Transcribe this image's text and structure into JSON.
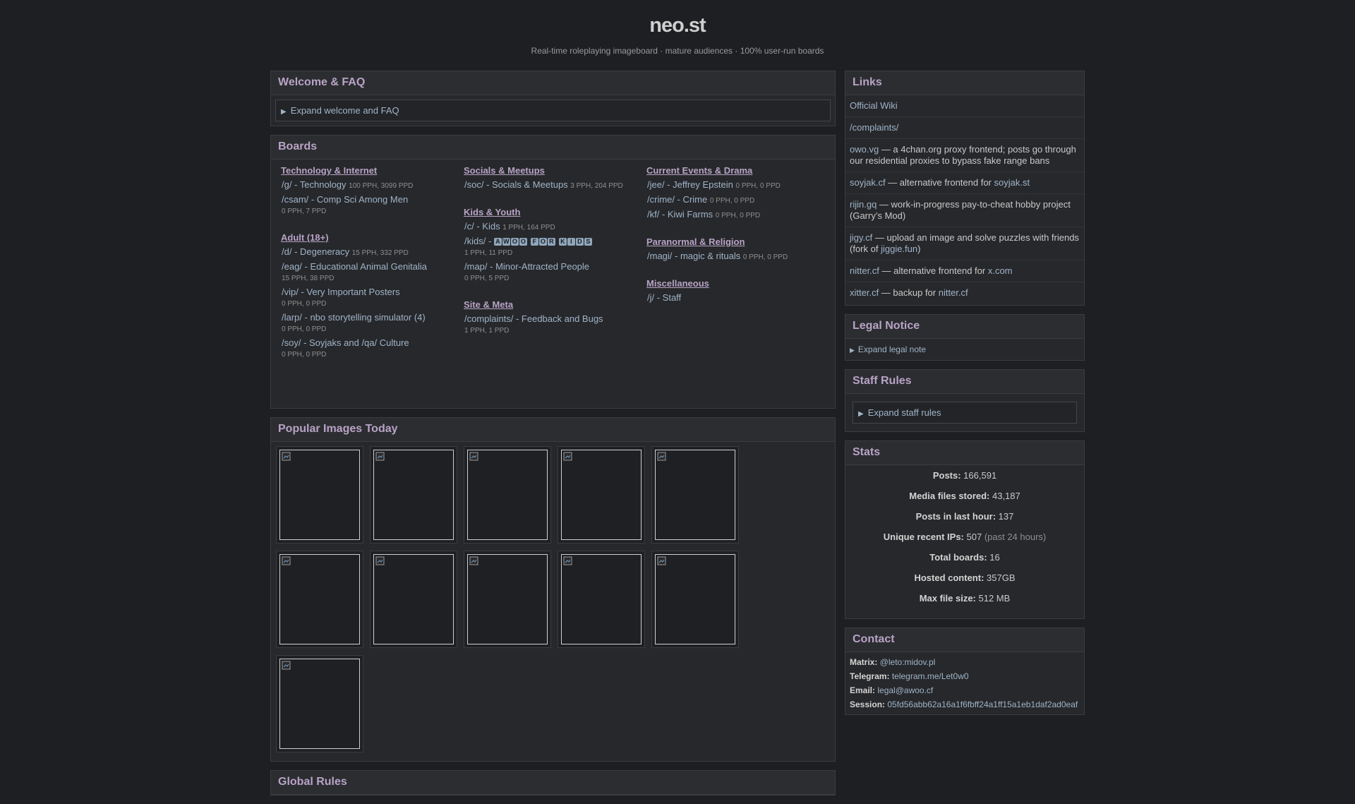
{
  "site": {
    "title": "neo.st",
    "tagline": "Real-time roleplaying imageboard · mature audiences · 100% user-run boards"
  },
  "welcome": {
    "title": "Welcome & FAQ",
    "expand_label": "Expand welcome and FAQ"
  },
  "boards_panel": {
    "title": "Boards",
    "columns": [
      [
        {
          "name": "Technology & Internet",
          "boards": [
            {
              "label": "/g/ - Technology",
              "stat": "100 PPH, 3099 PPD",
              "stat_block": false
            },
            {
              "label": "/csam/ - Comp Sci Among Men",
              "stat": "0 PPH, 7 PPD",
              "stat_block": true
            }
          ]
        },
        {
          "name": "Adult (18+)",
          "boards": [
            {
              "label": "/d/ - Degeneracy",
              "stat": "15 PPH, 332 PPD",
              "stat_block": false
            },
            {
              "label": "/eag/ - Educational Animal Genitalia",
              "stat": "15 PPH, 38 PPD",
              "stat_block": true
            },
            {
              "label": "/vip/ - Very Important Posters",
              "stat": "0 PPH, 0 PPD",
              "stat_block": true
            },
            {
              "label": "/larp/ - nbo storytelling simulator (4)",
              "stat": "0 PPH, 0 PPD",
              "stat_block": true
            },
            {
              "label": "/soy/ - Soyjaks and /qa/ Culture",
              "stat": "0 PPH, 0 PPD",
              "stat_block": true
            }
          ]
        }
      ],
      [
        {
          "name": "Socials & Meetups",
          "boards": [
            {
              "label": "/soc/ - Socials & Meetups",
              "stat": "3 PPH, 204 PPD",
              "stat_block": false
            }
          ]
        },
        {
          "name": "Kids & Youth",
          "boards": [
            {
              "label": "/c/ - Kids",
              "stat": "1 PPH, 164 PPD",
              "stat_block": false
            },
            {
              "label": "/kids/ - ",
              "chips": "AWOO FOR KIDS",
              "stat": "1 PPH, 11 PPD",
              "stat_block": true
            },
            {
              "label": "/map/ - Minor-Attracted People",
              "stat": "0 PPH, 5 PPD",
              "stat_block": true
            }
          ]
        },
        {
          "name": "Site & Meta",
          "boards": [
            {
              "label": "/complaints/ - Feedback and Bugs",
              "stat": "1 PPH, 1 PPD",
              "stat_block": true
            }
          ]
        }
      ],
      [
        {
          "name": "Current Events & Drama",
          "boards": [
            {
              "label": "/jee/ - Jeffrey Epstein",
              "stat": "0 PPH, 0 PPD",
              "stat_block": false
            },
            {
              "label": "/crime/ - Crime",
              "stat": "0 PPH, 0 PPD",
              "stat_block": false
            },
            {
              "label": "/kf/ - Kiwi Farms",
              "stat": "0 PPH, 0 PPD",
              "stat_block": false
            }
          ]
        },
        {
          "name": "Paranormal & Religion",
          "boards": [
            {
              "label": "/magi/ - magic & rituals",
              "stat": "0 PPH, 0 PPD",
              "stat_block": false
            }
          ]
        },
        {
          "name": "Miscellaneous",
          "boards": [
            {
              "label": "/j/ - Staff",
              "stat": "",
              "stat_block": false
            }
          ]
        }
      ]
    ]
  },
  "popular": {
    "title": "Popular Images Today",
    "count": 11
  },
  "global_rules": {
    "title": "Global Rules"
  },
  "links": {
    "title": "Links",
    "items": [
      {
        "link": "Official Wiki",
        "text": "",
        "link2": "",
        "tail": ""
      },
      {
        "link": "/complaints/",
        "text": "",
        "link2": "",
        "tail": ""
      },
      {
        "link": "owo.vg",
        "text": " — a 4chan.org proxy frontend; posts go through our residential proxies to bypass fake range bans",
        "link2": "",
        "tail": ""
      },
      {
        "link": "soyjak.cf",
        "text": " — alternative frontend for ",
        "link2": "soyjak.st",
        "tail": ""
      },
      {
        "link": "rijin.gq",
        "text": " — work-in-progress pay-to-cheat hobby project (Garry’s Mod)",
        "link2": "",
        "tail": ""
      },
      {
        "link": "jigy.cf",
        "text": " — upload an image and solve puzzles with friends (fork of ",
        "link2": "jiggie.fun",
        "tail": ")"
      },
      {
        "link": "nitter.cf",
        "text": " — alternative frontend for ",
        "link2": "x.com",
        "tail": ""
      },
      {
        "link": "xitter.cf",
        "text": " — backup for ",
        "link2": "nitter.cf",
        "tail": ""
      }
    ]
  },
  "legal": {
    "title": "Legal Notice",
    "expand_label": "Expand legal note"
  },
  "staff_rules": {
    "title": "Staff Rules",
    "expand_label": "Expand staff rules"
  },
  "stats": {
    "title": "Stats",
    "items": [
      {
        "label": "Posts:",
        "value": " 166,591",
        "extra": ""
      },
      {
        "label": "Media files stored:",
        "value": " 43,187",
        "extra": ""
      },
      {
        "label": "Posts in last hour:",
        "value": " 137",
        "extra": ""
      },
      {
        "label": "Unique recent IPs:",
        "value": " 507 ",
        "extra": "(past 24 hours)"
      },
      {
        "label": "Total boards:",
        "value": " 16",
        "extra": ""
      },
      {
        "label": "Hosted content:",
        "value": " 357GB",
        "extra": ""
      },
      {
        "label": "Max file size:",
        "value": " 512 MB",
        "extra": ""
      }
    ]
  },
  "contact": {
    "title": "Contact",
    "items": [
      {
        "label": "Matrix:",
        "value": "@leto:midov.pl"
      },
      {
        "label": "Telegram:",
        "value": "telegram.me/Let0w0"
      },
      {
        "label": "Email:",
        "value": "legal@awoo.cf"
      },
      {
        "label": "Session:",
        "value": "05fd56abb62a16a1f6fbff24a1ff15a1eb1daf2ad0eaf"
      }
    ]
  }
}
